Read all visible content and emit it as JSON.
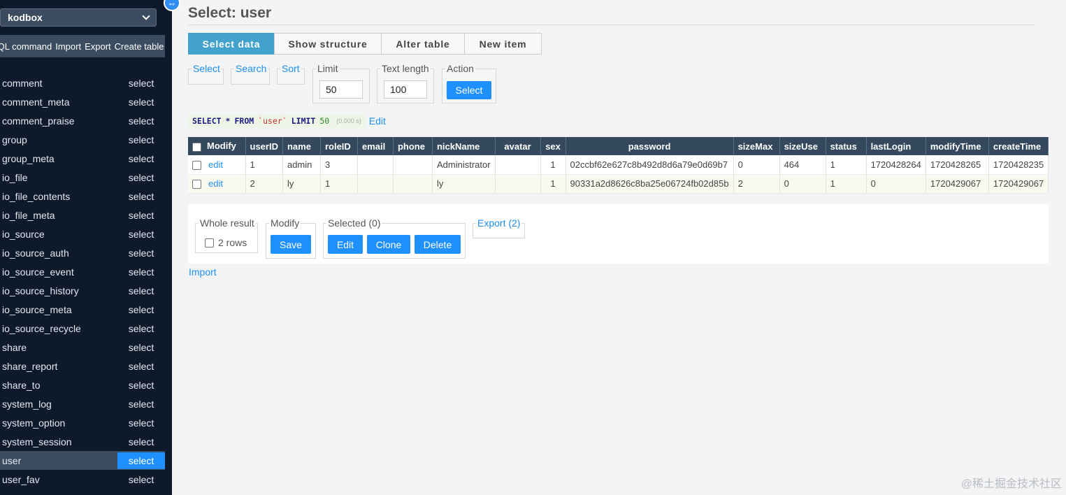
{
  "sidebar": {
    "database": "kodbox",
    "links": [
      "SQL command",
      "Import",
      "Export",
      "Create table"
    ],
    "select_label": "select",
    "tables": [
      "comment",
      "comment_meta",
      "comment_praise",
      "group",
      "group_meta",
      "io_file",
      "io_file_contents",
      "io_file_meta",
      "io_source",
      "io_source_auth",
      "io_source_event",
      "io_source_history",
      "io_source_meta",
      "io_source_recycle",
      "share",
      "share_report",
      "share_to",
      "system_log",
      "system_option",
      "system_session",
      "user",
      "user_fav"
    ],
    "active_table": "user"
  },
  "page": {
    "title": "Select: user",
    "tabs": [
      "Select data",
      "Show structure",
      "Alter table",
      "New item"
    ],
    "active_tab": "Select data"
  },
  "form": {
    "select_legend": "Select",
    "search_legend": "Search",
    "sort_legend": "Sort",
    "limit_legend": "Limit",
    "limit_value": "50",
    "text_length_legend": "Text length",
    "text_length_value": "100",
    "action_legend": "Action",
    "action_button": "Select"
  },
  "query": {
    "select": "SELECT",
    "star": "*",
    "from": "FROM",
    "table": "`user`",
    "limit": "LIMIT",
    "limit_value": "50",
    "time": "(0.000 s)",
    "edit": "Edit"
  },
  "table": {
    "modify_header": "Modify",
    "columns": [
      "userID",
      "name",
      "roleID",
      "email",
      "phone",
      "nickName",
      "avatar",
      "sex",
      "password",
      "sizeMax",
      "sizeUse",
      "status",
      "lastLogin",
      "modifyTime",
      "createTime"
    ],
    "edit_label": "edit",
    "rows": [
      [
        "1",
        "admin",
        "3",
        "",
        "",
        "Administrator",
        "",
        "1",
        "02ccbf62e627c8b492d8d6a79e0d69b7",
        "0",
        "464",
        "1",
        "1720428264",
        "1720428265",
        "1720428235"
      ],
      [
        "2",
        "ly",
        "1",
        "",
        "",
        "ly",
        "",
        "1",
        "90331a2d8626c8ba25e06724fb02d85b",
        "2",
        "0",
        "1",
        "0",
        "1720429067",
        "1720429067"
      ]
    ]
  },
  "bottom": {
    "whole_result_legend": "Whole result",
    "rows_label": "2 rows",
    "modify_legend": "Modify",
    "save_button": "Save",
    "selected_legend": "Selected (0)",
    "edit_button": "Edit",
    "clone_button": "Clone",
    "delete_button": "Delete",
    "export_legend": "Export (2)",
    "import_link": "Import"
  },
  "watermark": "@稀土掘金技术社区",
  "colors": {
    "sidebar_bg": "#0e1a2b",
    "accent": "#1e90ff",
    "tab_active": "#42a2cc",
    "table_header": "#34495e"
  }
}
